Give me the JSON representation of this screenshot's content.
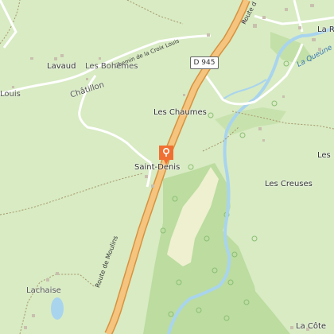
{
  "map": {
    "places": {
      "saint_denis": "Saint-Denis",
      "les_chaumes": "Les Chaumes",
      "lavaud": "Lavaud",
      "les_bohemes": "Les Bohèmes",
      "chatillon": "Châtillon",
      "louis": "Louis",
      "les_creuses": "Les Creuses",
      "la_cote": "La Côte",
      "lachaise": "Lachaise",
      "la_r": "La R",
      "les_right": "Les"
    },
    "roads": {
      "route_moulins": "Route de Moulins",
      "route_top": "Route d",
      "chemin": "Chemin de la Croix Louis",
      "d945": "D 945"
    },
    "water": {
      "river": "La Queune"
    },
    "colors": {
      "background": "#d8ebc3",
      "main_road": "#f5c47e",
      "main_road_casing": "#d7923f",
      "river": "#a9d4ee",
      "pin": "#f07033",
      "forest": "#bcdca0"
    },
    "marker": {
      "icon": "location-pin-icon"
    }
  }
}
